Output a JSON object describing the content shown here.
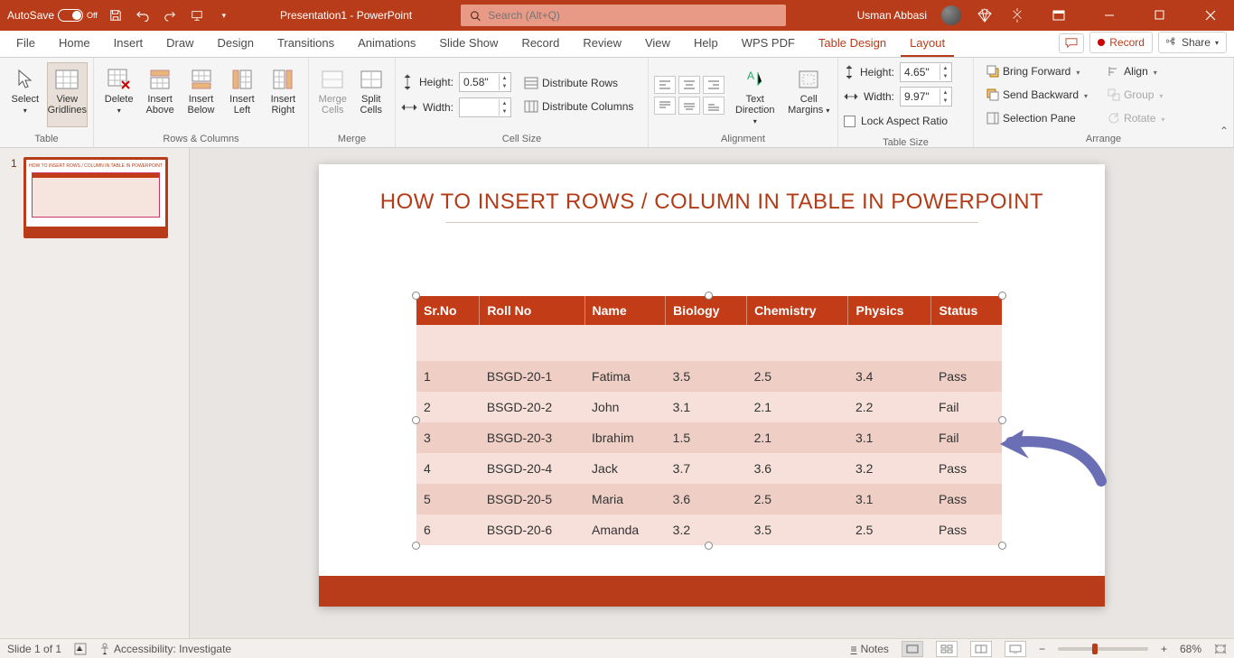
{
  "titlebar": {
    "autosave_label": "AutoSave",
    "autosave_state": "Off",
    "filename": "Presentation1 - PowerPoint",
    "search_placeholder": "Search (Alt+Q)",
    "user": "Usman Abbasi"
  },
  "tabs": {
    "items": [
      "File",
      "Home",
      "Insert",
      "Draw",
      "Design",
      "Transitions",
      "Animations",
      "Slide Show",
      "Record",
      "Review",
      "View",
      "Help",
      "WPS PDF",
      "Table Design",
      "Layout"
    ],
    "active": "Layout",
    "record_btn": "Record",
    "share_btn": "Share"
  },
  "ribbon": {
    "groups": {
      "table": {
        "label": "Table",
        "select": "Select",
        "gridlines": "View Gridlines"
      },
      "rows_cols": {
        "label": "Rows & Columns",
        "delete": "Delete",
        "ins_above": "Insert Above",
        "ins_below": "Insert Below",
        "ins_left": "Insert Left",
        "ins_right": "Insert Right"
      },
      "merge": {
        "label": "Merge",
        "merge": "Merge Cells",
        "split": "Split Cells"
      },
      "cellsize": {
        "label": "Cell Size",
        "height_lbl": "Height:",
        "height_val": "0.58\"",
        "width_lbl": "Width:",
        "width_val": "",
        "dist_rows": "Distribute Rows",
        "dist_cols": "Distribute Columns"
      },
      "alignment": {
        "label": "Alignment",
        "text_dir": "Text Direction",
        "cell_margins": "Cell Margins"
      },
      "tablesize": {
        "label": "Table Size",
        "height_lbl": "Height:",
        "height_val": "4.65\"",
        "width_lbl": "Width:",
        "width_val": "9.97\"",
        "lock": "Lock Aspect Ratio"
      },
      "arrange": {
        "label": "Arrange",
        "bring_fwd": "Bring Forward",
        "send_bwd": "Send Backward",
        "sel_pane": "Selection Pane",
        "align": "Align",
        "group": "Group",
        "rotate": "Rotate"
      }
    }
  },
  "slide": {
    "title": "HOW TO INSERT ROWS / COLUMN IN TABLE IN POWERPOINT"
  },
  "chart_data": {
    "type": "table",
    "headers": [
      "Sr.No",
      "Roll No",
      "Name",
      "Biology",
      "Chemistry",
      "Physics",
      "Status"
    ],
    "rows": [
      [
        "1",
        "BSGD-20-1",
        "Fatima",
        "3.5",
        "2.5",
        "3.4",
        "Pass"
      ],
      [
        "2",
        "BSGD-20-2",
        "John",
        "3.1",
        "2.1",
        "2.2",
        "Fail"
      ],
      [
        "3",
        "BSGD-20-3",
        "Ibrahim",
        "1.5",
        "2.1",
        "3.1",
        "Fail"
      ],
      [
        "4",
        "BSGD-20-4",
        "Jack",
        "3.7",
        "3.6",
        "3.2",
        "Pass"
      ],
      [
        "5",
        "BSGD-20-5",
        "Maria",
        "3.6",
        "2.5",
        "3.1",
        "Pass"
      ],
      [
        "6",
        "BSGD-20-6",
        "Amanda",
        "3.2",
        "3.5",
        "2.5",
        "Pass"
      ]
    ]
  },
  "thumbnail": {
    "index": "1"
  },
  "status": {
    "slide": "Slide 1 of 1",
    "accessibility": "Accessibility: Investigate",
    "notes": "Notes",
    "zoom": "68%"
  }
}
